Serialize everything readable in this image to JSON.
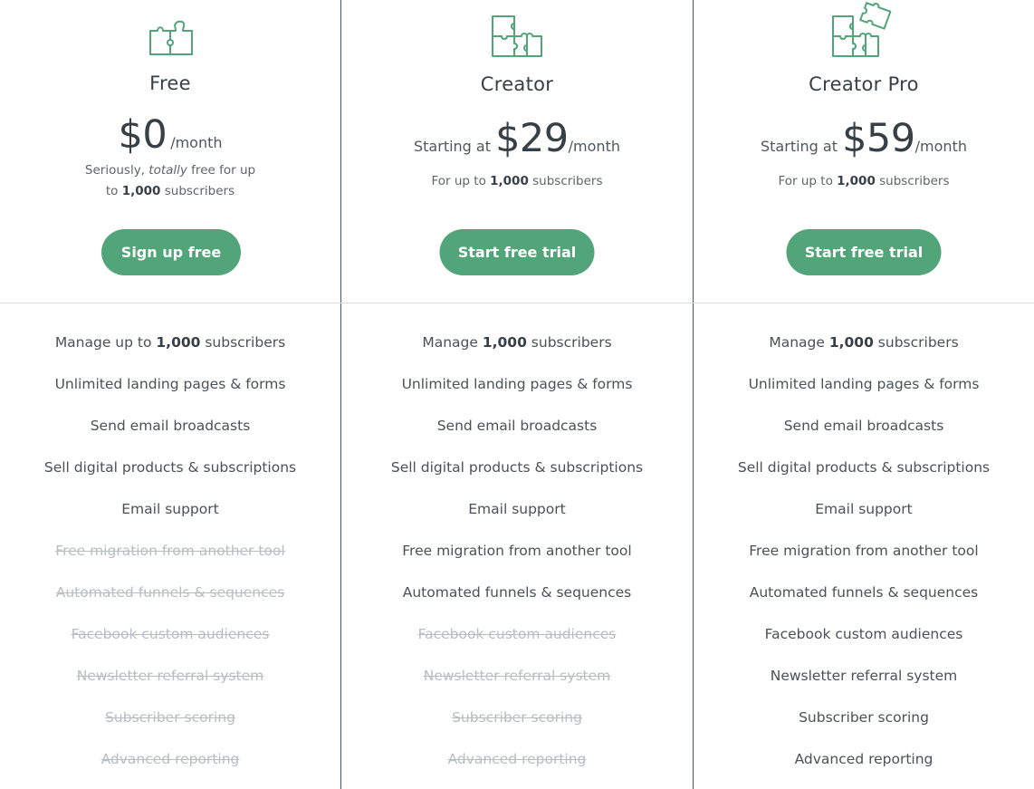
{
  "theme": {
    "accent": "#52a578",
    "divider_vertical": "#4a5568",
    "divider_horizontal": "#dcdcdc",
    "text_primary": "#373f47",
    "text_disabled": "#b8bdc2"
  },
  "plans": [
    {
      "name": "Free",
      "icon": "puzzle-two-pieces-icon",
      "price_prefix": "",
      "price_amount": "$0",
      "price_suffix": "/month",
      "subtext_parts": [
        "Seriously, ",
        "totally",
        " free for up",
        "to ",
        "1,000",
        " subscribers"
      ],
      "cta_label": "Sign up free",
      "features": [
        {
          "pre": "Manage up to ",
          "bold": "1,000",
          "post": " subscribers",
          "included": true
        },
        {
          "pre": "Unlimited landing pages & forms",
          "bold": "",
          "post": "",
          "included": true
        },
        {
          "pre": "Send email broadcasts",
          "bold": "",
          "post": "",
          "included": true
        },
        {
          "pre": "Sell digital products & subscriptions",
          "bold": "",
          "post": "",
          "included": true
        },
        {
          "pre": "Email support",
          "bold": "",
          "post": "",
          "included": true
        },
        {
          "pre": "Free migration from another tool",
          "bold": "",
          "post": "",
          "included": false
        },
        {
          "pre": "Automated funnels & sequences",
          "bold": "",
          "post": "",
          "included": false
        },
        {
          "pre": "Facebook custom audiences",
          "bold": "",
          "post": "",
          "included": false
        },
        {
          "pre": "Newsletter referral system",
          "bold": "",
          "post": "",
          "included": false
        },
        {
          "pre": "Subscriber scoring",
          "bold": "",
          "post": "",
          "included": false
        },
        {
          "pre": "Advanced reporting",
          "bold": "",
          "post": "",
          "included": false
        }
      ]
    },
    {
      "name": "Creator",
      "icon": "puzzle-four-pieces-icon",
      "price_prefix": "Starting at ",
      "price_amount": "$29",
      "price_suffix": "/month",
      "subtext_parts": [
        "For up to ",
        "1,000",
        " subscribers"
      ],
      "cta_label": "Start free trial",
      "features": [
        {
          "pre": "Manage ",
          "bold": "1,000",
          "post": " subscribers",
          "included": true
        },
        {
          "pre": "Unlimited landing pages & forms",
          "bold": "",
          "post": "",
          "included": true
        },
        {
          "pre": "Send email broadcasts",
          "bold": "",
          "post": "",
          "included": true
        },
        {
          "pre": "Sell digital products & subscriptions",
          "bold": "",
          "post": "",
          "included": true
        },
        {
          "pre": "Email support",
          "bold": "",
          "post": "",
          "included": true
        },
        {
          "pre": "Free migration from another tool",
          "bold": "",
          "post": "",
          "included": true
        },
        {
          "pre": "Automated funnels & sequences",
          "bold": "",
          "post": "",
          "included": true
        },
        {
          "pre": "Facebook custom audiences",
          "bold": "",
          "post": "",
          "included": false
        },
        {
          "pre": "Newsletter referral system",
          "bold": "",
          "post": "",
          "included": false
        },
        {
          "pre": "Subscriber scoring",
          "bold": "",
          "post": "",
          "included": false
        },
        {
          "pre": "Advanced reporting",
          "bold": "",
          "post": "",
          "included": false
        }
      ]
    },
    {
      "name": "Creator Pro",
      "icon": "puzzle-five-pieces-icon",
      "price_prefix": "Starting at ",
      "price_amount": "$59",
      "price_suffix": "/month",
      "subtext_parts": [
        "For up to ",
        "1,000",
        " subscribers"
      ],
      "cta_label": "Start free trial",
      "features": [
        {
          "pre": "Manage ",
          "bold": "1,000",
          "post": " subscribers",
          "included": true
        },
        {
          "pre": "Unlimited landing pages & forms",
          "bold": "",
          "post": "",
          "included": true
        },
        {
          "pre": "Send email broadcasts",
          "bold": "",
          "post": "",
          "included": true
        },
        {
          "pre": "Sell digital products & subscriptions",
          "bold": "",
          "post": "",
          "included": true
        },
        {
          "pre": "Email support",
          "bold": "",
          "post": "",
          "included": true
        },
        {
          "pre": "Free migration from another tool",
          "bold": "",
          "post": "",
          "included": true
        },
        {
          "pre": "Automated funnels & sequences",
          "bold": "",
          "post": "",
          "included": true
        },
        {
          "pre": "Facebook custom audiences",
          "bold": "",
          "post": "",
          "included": true
        },
        {
          "pre": "Newsletter referral system",
          "bold": "",
          "post": "",
          "included": true
        },
        {
          "pre": "Subscriber scoring",
          "bold": "",
          "post": "",
          "included": true
        },
        {
          "pre": "Advanced reporting",
          "bold": "",
          "post": "",
          "included": true
        }
      ]
    }
  ]
}
